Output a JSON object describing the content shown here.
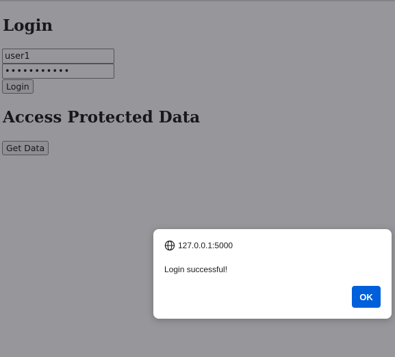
{
  "login": {
    "title": "Login",
    "username_value": "user1",
    "password_value": "•••••••••••",
    "button_label": "Login"
  },
  "protected": {
    "title": "Access Protected Data",
    "button_label": "Get Data"
  },
  "dialog": {
    "origin": "127.0.0.1:5000",
    "origin_icon": "globe-icon",
    "message": "Login successful!",
    "ok_label": "OK"
  },
  "colors": {
    "overlay": "#969699",
    "ok_button": "#005fdb"
  }
}
